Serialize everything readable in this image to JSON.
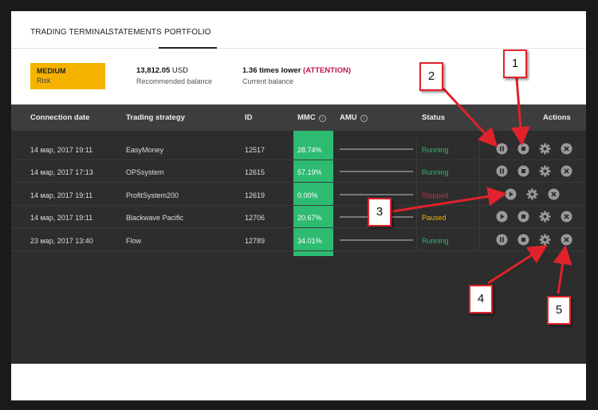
{
  "tabs": [
    {
      "label": "TRADING TERMINAL",
      "active": false
    },
    {
      "label": "STATEMENTS",
      "active": false
    },
    {
      "label": "PORTFOLIO",
      "active": true
    }
  ],
  "summary": {
    "risk_level": "MEDIUM",
    "risk_label": "Risk",
    "recommended_value": "13,812.05",
    "recommended_unit": "USD",
    "recommended_label": "Recommended balance",
    "current_value": "1.36 times lower",
    "current_attention": "(ATTENTION)",
    "current_label": "Current balance"
  },
  "table": {
    "headers": {
      "connection_date": "Connection date",
      "strategy": "Trading strategy",
      "id": "ID",
      "mmc": "MMC",
      "amu": "AMU",
      "status": "Status",
      "actions": "Actions"
    },
    "rows": [
      {
        "date": "14 мар, 2017 19:11",
        "strategy": "EasyMoney",
        "id": "12517",
        "mmc": "28.74%",
        "status": "Running",
        "status_kind": "running",
        "primary_action": "pause"
      },
      {
        "date": "14 мар, 2017 17:13",
        "strategy": "OPSsystem",
        "id": "12615",
        "mmc": "57.19%",
        "status": "Running",
        "status_kind": "running",
        "primary_action": "pause"
      },
      {
        "date": "14 мар, 2017 19:11",
        "strategy": "ProfitSystem200",
        "id": "12619",
        "mmc": "0.00%",
        "status": "Stopped",
        "status_kind": "stopped",
        "primary_action": "play"
      },
      {
        "date": "14 мар, 2017 19:11",
        "strategy": "Blackwave Pacific",
        "id": "12706",
        "mmc": "20.67%",
        "status": "Paused",
        "status_kind": "paused",
        "primary_action": "play"
      },
      {
        "date": "23 мар, 2017 13:40",
        "strategy": "Flow",
        "id": "12789",
        "mmc": "34.01%",
        "status": "Running",
        "status_kind": "running",
        "primary_action": "pause"
      }
    ]
  },
  "annotations": [
    "1",
    "2",
    "3",
    "4",
    "5"
  ],
  "colors": {
    "accent_green": "#2dbb72",
    "risk_yellow": "#f5b300",
    "stopped_red": "#d9283d",
    "callout_red": "#e0232b"
  },
  "icons": [
    "pause-icon",
    "play-icon",
    "stop-icon",
    "gear-icon",
    "close-icon",
    "info-icon"
  ]
}
